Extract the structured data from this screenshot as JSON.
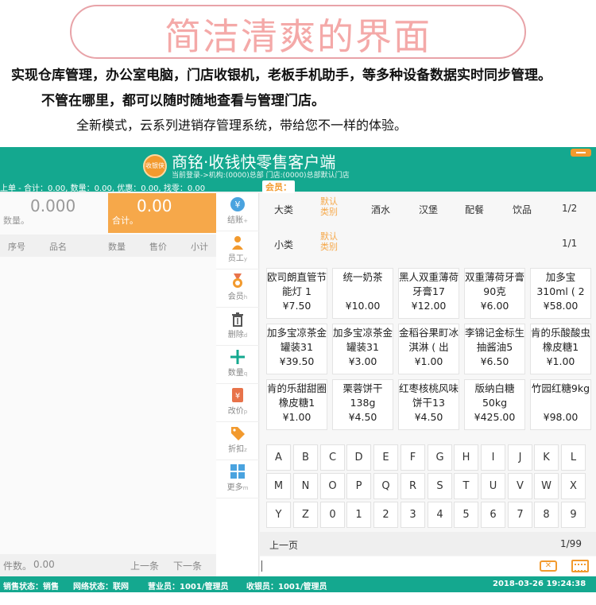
{
  "promo": {
    "title": "简洁清爽的界面",
    "line1": "实现仓库管理，办公室电脑，门店收银机，老板手机助手，等多种设备数据实时同步管理。",
    "line2": "不管在哪里，都可以随时随地查看与管理门店。",
    "line3": "全新模式，云系列进销存管理系统，带给您不一样的体验。"
  },
  "app": {
    "logo_text": "收银侠",
    "title": "商铭·收钱快零售客户端",
    "subtitle": "当前登录->机构:(0000)总部 门店:(0000)总部默认门店",
    "info_bar": "上单 - 合计：0.00, 数量：0.00, 优惠：0.00, 找零：0.00",
    "member_label": "会员："
  },
  "left": {
    "qty_value": "0.000",
    "qty_label": "数量。",
    "sum_value": "0.00",
    "sum_label": "合计。",
    "columns": [
      "序号",
      "品名",
      "数量",
      "售价",
      "小计"
    ],
    "count_label": "件数。",
    "count_value": "0.00",
    "prev": "上一条",
    "next": "下一条"
  },
  "functions": [
    {
      "label": "结账",
      "key": "+",
      "icon": "yen-icon",
      "color": "#4aa3df"
    },
    {
      "label": "员工",
      "key": "y",
      "icon": "staff-icon",
      "color": "#f29a2e"
    },
    {
      "label": "会员",
      "key": "h",
      "icon": "member-medal-icon",
      "color": "#f29a2e"
    },
    {
      "label": "删除",
      "key": "d",
      "icon": "trash-icon",
      "color": "#555555"
    },
    {
      "label": "数量",
      "key": "q",
      "icon": "plus-icon",
      "color": "#14a88f"
    },
    {
      "label": "改价",
      "key": "p",
      "icon": "price-tag-icon",
      "color": "#e8734a"
    },
    {
      "label": "折扣",
      "key": "z",
      "icon": "discount-tag-icon",
      "color": "#f29a2e"
    },
    {
      "label": "更多",
      "key": "m",
      "icon": "grid-more-icon",
      "color": "#4aa3df"
    }
  ],
  "categories": {
    "major_label": "大类",
    "major_selected": "默认类别",
    "major_items": [
      "酒水",
      "汉堡",
      "配餐",
      "饮品"
    ],
    "major_page": "1/2",
    "minor_label": "小类",
    "minor_selected": "默认类别",
    "minor_page": "1/1"
  },
  "products": [
    {
      "name": "欧司朗直管节能灯 1",
      "price": "¥7.50"
    },
    {
      "name": "统一奶茶",
      "price": "¥10.00"
    },
    {
      "name": "黑人双重薄荷牙膏17",
      "price": "¥12.00"
    },
    {
      "name": "双重薄荷牙膏90克",
      "price": "¥6.00"
    },
    {
      "name": "加多宝310ml ( 2",
      "price": "¥58.00"
    },
    {
      "name": "加多宝凉茶金罐装31",
      "price": "¥39.50"
    },
    {
      "name": "加多宝凉茶金罐装31",
      "price": "¥3.00"
    },
    {
      "name": "金稻谷果町冰淇淋 ( 出",
      "price": "¥1.00"
    },
    {
      "name": "李锦记金标生抽酱油5",
      "price": "¥6.50"
    },
    {
      "name": "肯的乐酸酸虫橡皮糖1",
      "price": "¥1.00"
    },
    {
      "name": "肯的乐甜甜圈橡皮糖1",
      "price": "¥1.00"
    },
    {
      "name": "栗蓉饼干138g",
      "price": "¥4.50"
    },
    {
      "name": "红枣核桃风味饼干13",
      "price": "¥4.50"
    },
    {
      "name": "版纳白糖50kg",
      "price": "¥425.00"
    },
    {
      "name": "竹园红糖9kg",
      "price": "¥98.00"
    }
  ],
  "keyboard": [
    [
      "A",
      "B",
      "C",
      "D",
      "E",
      "F",
      "G",
      "H",
      "I",
      "J",
      "K",
      "L"
    ],
    [
      "M",
      "N",
      "O",
      "P",
      "Q",
      "R",
      "S",
      "T",
      "U",
      "V",
      "W",
      "X"
    ],
    [
      "Y",
      "Z",
      "0",
      "1",
      "2",
      "3",
      "4",
      "5",
      "6",
      "7",
      "8",
      "9"
    ]
  ],
  "pager": {
    "prev": "上一页",
    "page": "1/99"
  },
  "status": {
    "sales": "销售状态：销售",
    "network": "网络状态：联网",
    "clerk": "营业员：1001/管理员",
    "cashier": "收银员：1001/管理员",
    "datetime": "2018-03-26  19:24:38"
  },
  "colors": {
    "brand": "#14a88f",
    "accent": "#f6a84a"
  }
}
